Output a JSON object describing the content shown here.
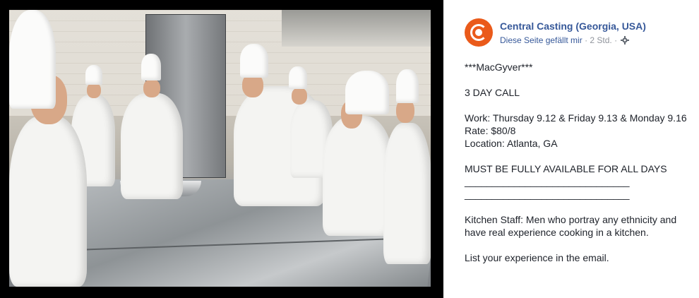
{
  "post": {
    "page_name": "Central Casting (Georgia, USA)",
    "like_text": "Diese Seite gefällt mir",
    "separator": "·",
    "time": "2 Std.",
    "icons": {
      "avatar": "central-casting-logo",
      "settings": "gear-icon"
    },
    "lines": [
      "***MacGyver***",
      "",
      "3 DAY CALL",
      "",
      "Work: Thursday 9.12 & Friday 9.13 & Monday 9.16",
      "Rate: $80/8",
      "Location: Atlanta, GA",
      "",
      "MUST BE FULLY AVAILABLE FOR ALL DAYS",
      "______________________________",
      "______________________________",
      "",
      "Kitchen Staff: Men who portray any ethnicity and",
      "have real experience cooking in a kitchen.",
      "",
      "List your experience in the email."
    ]
  },
  "colors": {
    "link": "#365899",
    "meta": "#90949c",
    "text": "#1d2129",
    "logo": "#ea5a1a"
  }
}
